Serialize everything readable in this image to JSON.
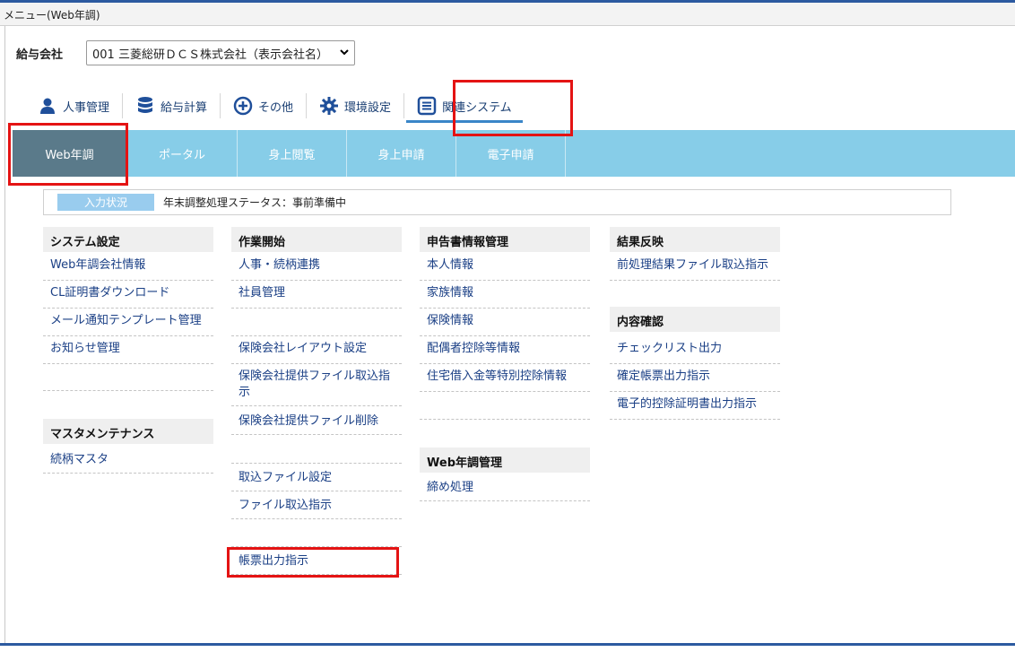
{
  "window": {
    "title": "メニュー(Web年調)"
  },
  "company": {
    "label": "給与会社",
    "selected": "001 三菱総研ＤＣＳ株式会社（表示会社名）"
  },
  "nav_tabs": [
    {
      "label": "人事管理",
      "icon": "person-icon"
    },
    {
      "label": "給与計算",
      "icon": "database-icon"
    },
    {
      "label": "その他",
      "icon": "plus-circle-icon"
    },
    {
      "label": "環境設定",
      "icon": "gear-icon"
    },
    {
      "label": "関連システム",
      "icon": "list-icon"
    }
  ],
  "subnav": [
    {
      "label": "Web年調"
    },
    {
      "label": "ポータル"
    },
    {
      "label": "身上閲覧"
    },
    {
      "label": "身上申請"
    },
    {
      "label": "電子申請"
    }
  ],
  "status": {
    "label": "入力状況",
    "text": "年末調整処理ステータス：事前準備中"
  },
  "colors": {
    "accent": "#2c5aa0",
    "subnav_bg": "#87cde8",
    "subnav_active": "#5a7a8a",
    "highlight": "#e41313",
    "link": "#1a3f85"
  },
  "menu": {
    "system_settings": {
      "heading": "システム設定",
      "items": [
        "Web年調会社情報",
        "CL証明書ダウンロード",
        "メール通知テンプレート管理",
        "お知らせ管理"
      ]
    },
    "master_maintenance": {
      "heading": "マスタメンテナンス",
      "items": [
        "続柄マスタ"
      ]
    },
    "work_start": {
      "heading": "作業開始",
      "items": [
        "人事・続柄連携",
        "社員管理",
        "保険会社レイアウト設定",
        "保険会社提供ファイル取込指示",
        "保険会社提供ファイル削除",
        "取込ファイル設定",
        "ファイル取込指示",
        "帳票出力指示"
      ]
    },
    "declaration": {
      "heading": "申告書情報管理",
      "items": [
        "本人情報",
        "家族情報",
        "保険情報",
        "配偶者控除等情報",
        "住宅借入金等特別控除情報"
      ]
    },
    "web_admin": {
      "heading": "Web年調管理",
      "items": [
        "締め処理"
      ]
    },
    "result": {
      "heading": "結果反映",
      "items": [
        "前処理結果ファイル取込指示"
      ]
    },
    "confirm": {
      "heading": "内容確認",
      "items": [
        "チェックリスト出力",
        "確定帳票出力指示",
        "電子的控除証明書出力指示"
      ]
    }
  }
}
